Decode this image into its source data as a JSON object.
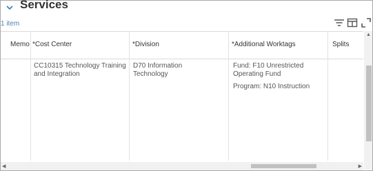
{
  "section": {
    "title": "Services",
    "count": "1 item"
  },
  "toolbar": {
    "filter_icon": "filter-icon",
    "columns_icon": "column-layout-icon",
    "expand_icon": "expand-icon"
  },
  "table": {
    "columns": [
      "Memo",
      "*Cost Center",
      "*Division",
      "*Additional Worktags",
      "Splits"
    ],
    "row": {
      "memo": "",
      "cost_center": "CC10315 Technology Training and Integration",
      "division": "D70 Information Technology",
      "worktags": [
        "Fund: F10 Unrestricted Operating Fund",
        "Program: N10 Instruction"
      ],
      "splits": ""
    }
  },
  "colors": {
    "accent": "#4f7fb5",
    "border": "#d9d9d9",
    "scroll": "#c1c1c1"
  }
}
